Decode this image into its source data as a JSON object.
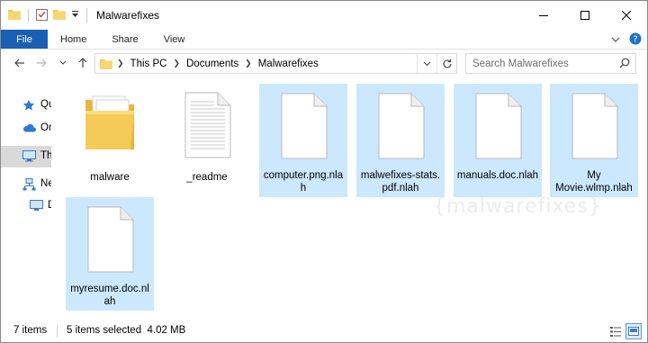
{
  "window": {
    "title": "Malwarefixes"
  },
  "ribbon": {
    "file_tab": "File",
    "tabs": [
      "Home",
      "Share",
      "View"
    ]
  },
  "address": {
    "crumbs": [
      "This PC",
      "Documents",
      "Malwarefixes"
    ]
  },
  "search": {
    "placeholder": "Search Malwarefixes"
  },
  "navpane": {
    "items": [
      {
        "label": "Qu",
        "icon": "star-icon"
      },
      {
        "label": "On",
        "icon": "cloud-icon"
      },
      {
        "label": "Th",
        "icon": "computer-icon"
      },
      {
        "label": "Ne",
        "icon": "network-icon"
      },
      {
        "label": "D",
        "icon": "monitor-icon"
      }
    ]
  },
  "files": [
    {
      "name": "malware",
      "type": "folder",
      "selected": false
    },
    {
      "name": "_readme",
      "type": "text",
      "selected": false
    },
    {
      "name": "computer.png.nlah",
      "type": "blank",
      "selected": true
    },
    {
      "name": "malwefixes-stats.pdf.nlah",
      "type": "blank",
      "selected": true
    },
    {
      "name": "manuals.doc.nlah",
      "type": "blank",
      "selected": true
    },
    {
      "name": "My Movie.wlmp.nlah",
      "type": "blank",
      "selected": true
    },
    {
      "name": "myresume.doc.nlah",
      "type": "blank",
      "selected": true
    }
  ],
  "watermark": "{malwarefixes}",
  "status": {
    "item_count": "7 items",
    "selection": "5 items selected  4.02 MB"
  },
  "colors": {
    "accent": "#1a5fb4",
    "selection": "#cce8ff"
  }
}
